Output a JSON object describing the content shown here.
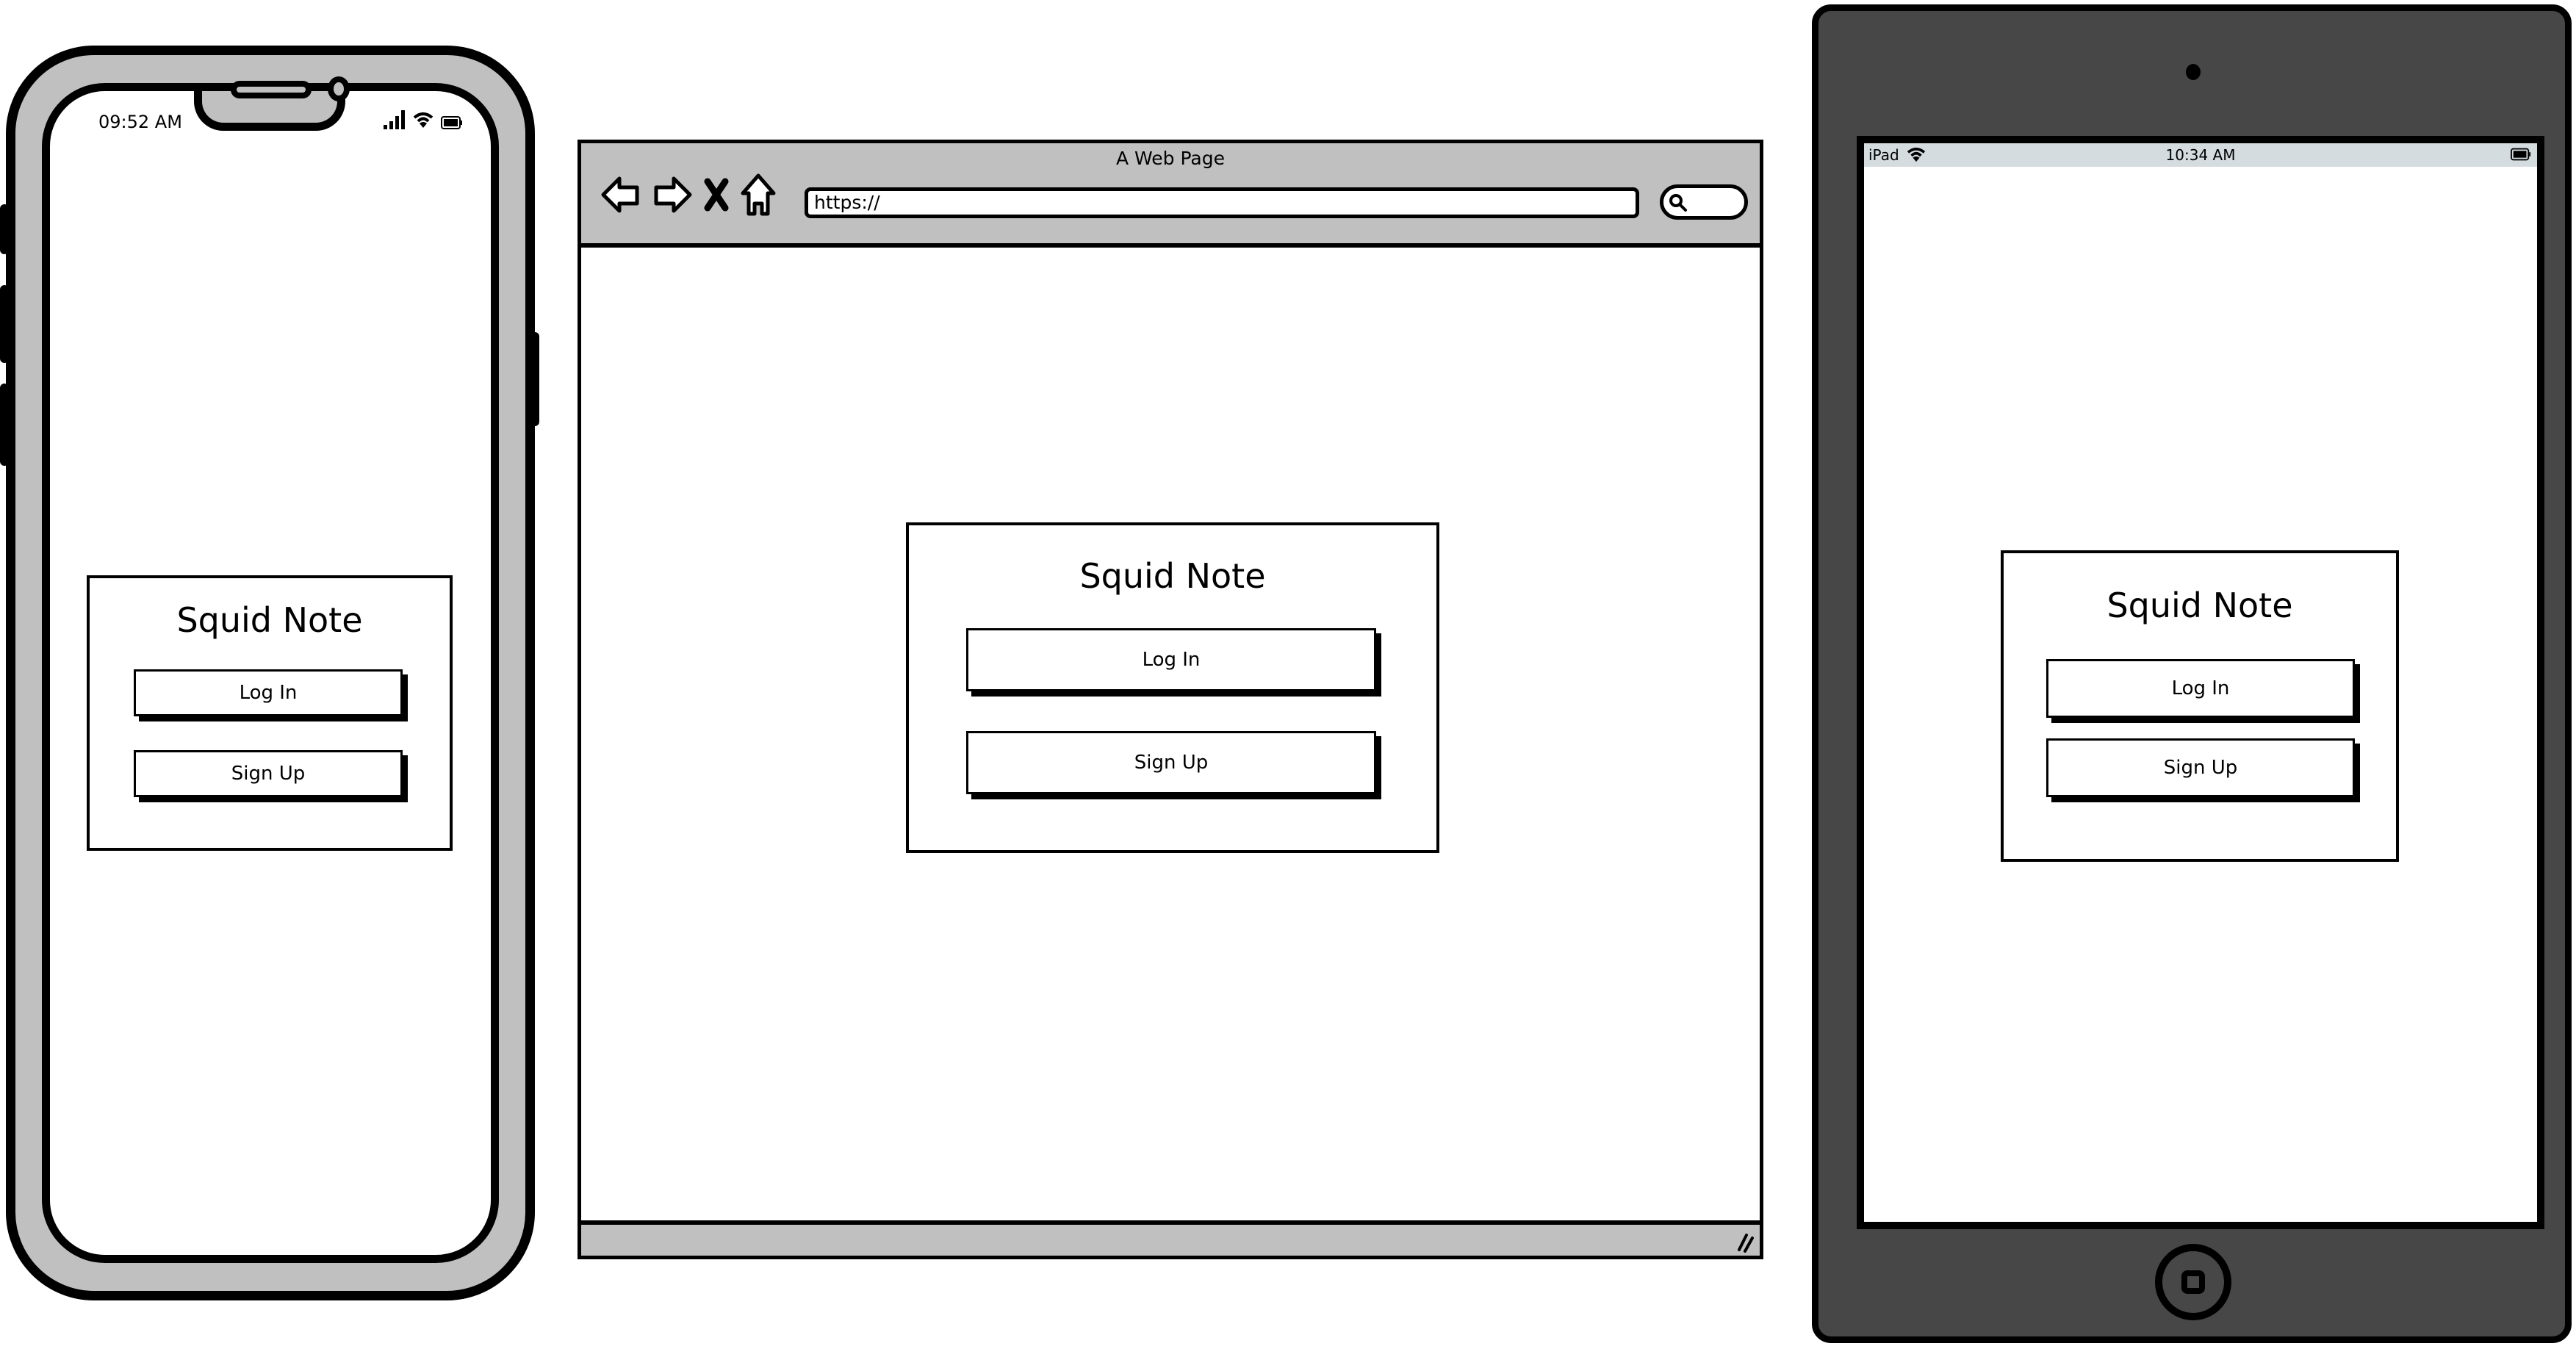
{
  "phone": {
    "status_time": "09:52 AM",
    "status_icons": [
      "signal-icon",
      "wifi-icon",
      "battery-icon"
    ],
    "app": {
      "title": "Squid Note",
      "login_label": "Log In",
      "signup_label": "Sign Up"
    }
  },
  "browser": {
    "window_title": "A Web Page",
    "nav_icons": [
      "back-arrow-icon",
      "forward-arrow-icon",
      "stop-x-icon",
      "home-icon"
    ],
    "url": "https://",
    "app": {
      "title": "Squid Note",
      "login_label": "Log In",
      "signup_label": "Sign Up"
    }
  },
  "tablet": {
    "status_carrier": "iPad",
    "status_time": "10:34 AM",
    "status_icons": [
      "wifi-icon",
      "battery-icon"
    ],
    "app": {
      "title": "Squid Note",
      "login_label": "Log In",
      "signup_label": "Sign Up"
    }
  },
  "colors": {
    "frame_gray": "#c0c0c0",
    "tablet_body": "#474747",
    "tablet_statusbar": "#d5dcdf",
    "ink": "#000000",
    "paper": "#ffffff"
  }
}
